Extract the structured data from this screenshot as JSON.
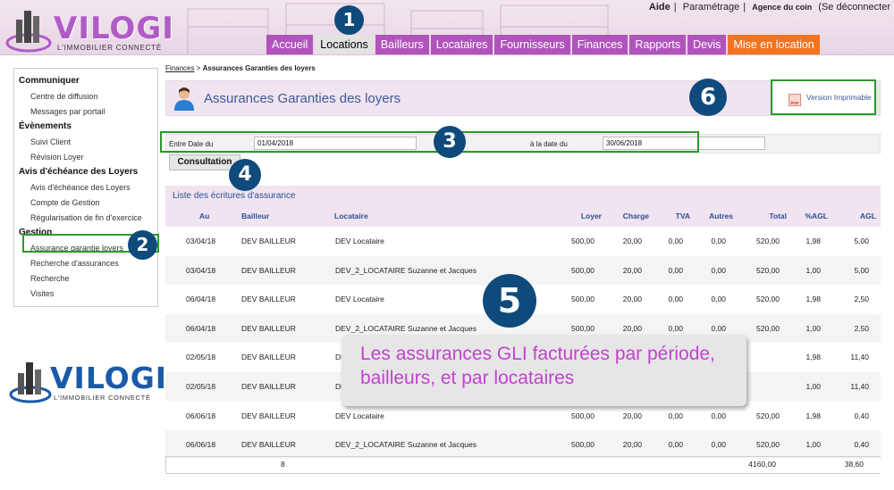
{
  "header": {
    "logo_text": "VILOGI",
    "logo_tagline": "L'IMMOBILIER CONNECTÉ",
    "top_links": [
      "Aide",
      "Paramétrage",
      "Agence du coin",
      "(Se déconnecter"
    ],
    "nav": [
      "Accueil",
      "Locations",
      "Bailleurs",
      "Locataires",
      "Fournisseurs",
      "Finances",
      "Rapports",
      "Devis",
      "Mise en location"
    ]
  },
  "sidebar": {
    "sections": [
      {
        "title": "Communiquer",
        "items": [
          "Centre de diffusion",
          "Messages par portail"
        ]
      },
      {
        "title": "Évènements",
        "items": [
          "Suivi Client",
          "Révision Loyer"
        ]
      },
      {
        "title": "Avis d'échéance des Loyers",
        "items": [
          "Avis d'échéance des Loyers",
          "Compte de Gestion",
          "Régularisation de fin d'exercice"
        ]
      },
      {
        "title": "Gestion",
        "items": [
          "Assurance garantie loyers",
          "Recherche d'assurances",
          "Recherche",
          "Visites"
        ]
      }
    ]
  },
  "breadcrumb": {
    "link": "Finances",
    "sep": " > ",
    "current": "Assurances Garanties des loyers"
  },
  "page": {
    "title": "Assurances Garanties des loyers",
    "print_label": "Version Imprimable",
    "pdf_icon_text": "PDF",
    "from_label": "Entre Date du",
    "from_value": "01/04/2018",
    "to_label": "à la date du",
    "to_value": "30/06/2018",
    "consult_button": "Consultation",
    "list_title": "Liste des écritures d'assurance"
  },
  "table": {
    "columns": [
      "Au",
      "Bailleur",
      "Locataire",
      "Loyer",
      "Charge",
      "TVA",
      "Autres",
      "Total",
      "%AGL",
      "AGL"
    ],
    "rows": [
      [
        "03/04/18",
        "DEV BAILLEUR",
        "DEV Locataire",
        "500,00",
        "20,00",
        "0,00",
        "0,00",
        "520,00",
        "1,98",
        "5,00"
      ],
      [
        "03/04/18",
        "DEV BAILLEUR",
        "DEV_2_LOCATAIRE Suzanne et Jacques",
        "500,00",
        "20,00",
        "0,00",
        "0,00",
        "520,00",
        "1,00",
        "5,00"
      ],
      [
        "06/04/18",
        "DEV BAILLEUR",
        "DEV Locataire",
        "500,00",
        "20,00",
        "0,00",
        "0,00",
        "520,00",
        "1,98",
        "2,50"
      ],
      [
        "06/04/18",
        "DEV BAILLEUR",
        "DEV_2_LOCATAIRE Suzanne et Jacques",
        "500,00",
        "20,00",
        "0,00",
        "0,00",
        "520,00",
        "1,00",
        "2,50"
      ],
      [
        "02/05/18",
        "DEV BAILLEUR",
        "DE",
        "",
        "",
        "",
        "",
        "",
        "1,98",
        "11,40"
      ],
      [
        "02/05/18",
        "DEV BAILLEUR",
        "DE",
        "",
        "",
        "",
        "",
        "",
        "1,00",
        "11,40"
      ],
      [
        "06/06/18",
        "DEV BAILLEUR",
        "DEV Locataire",
        "500,00",
        "20,00",
        "0,00",
        "0,00",
        "520,00",
        "1,98",
        "0,40"
      ],
      [
        "06/06/18",
        "DEV BAILLEUR",
        "DEV_2_LOCATAIRE Suzanne et Jacques",
        "500,00",
        "20,00",
        "0,00",
        "0,00",
        "520,00",
        "1,00",
        "0,40"
      ]
    ],
    "totals": {
      "count": "8",
      "total": "4160,00",
      "agl": "38,60"
    }
  },
  "callouts": {
    "badges": [
      "1",
      "2",
      "3",
      "4",
      "5",
      "6"
    ],
    "overlay_line1": "Les assurances GLI facturées par période,",
    "overlay_line2": "bailleurs, et par locataires"
  },
  "colors": {
    "nav_purple": "#b054bc",
    "nav_orange": "#f27320",
    "badge_blue": "#0f4a7c",
    "highlight_green": "#2a9a2a",
    "overlay_text": "#c43fd1"
  }
}
